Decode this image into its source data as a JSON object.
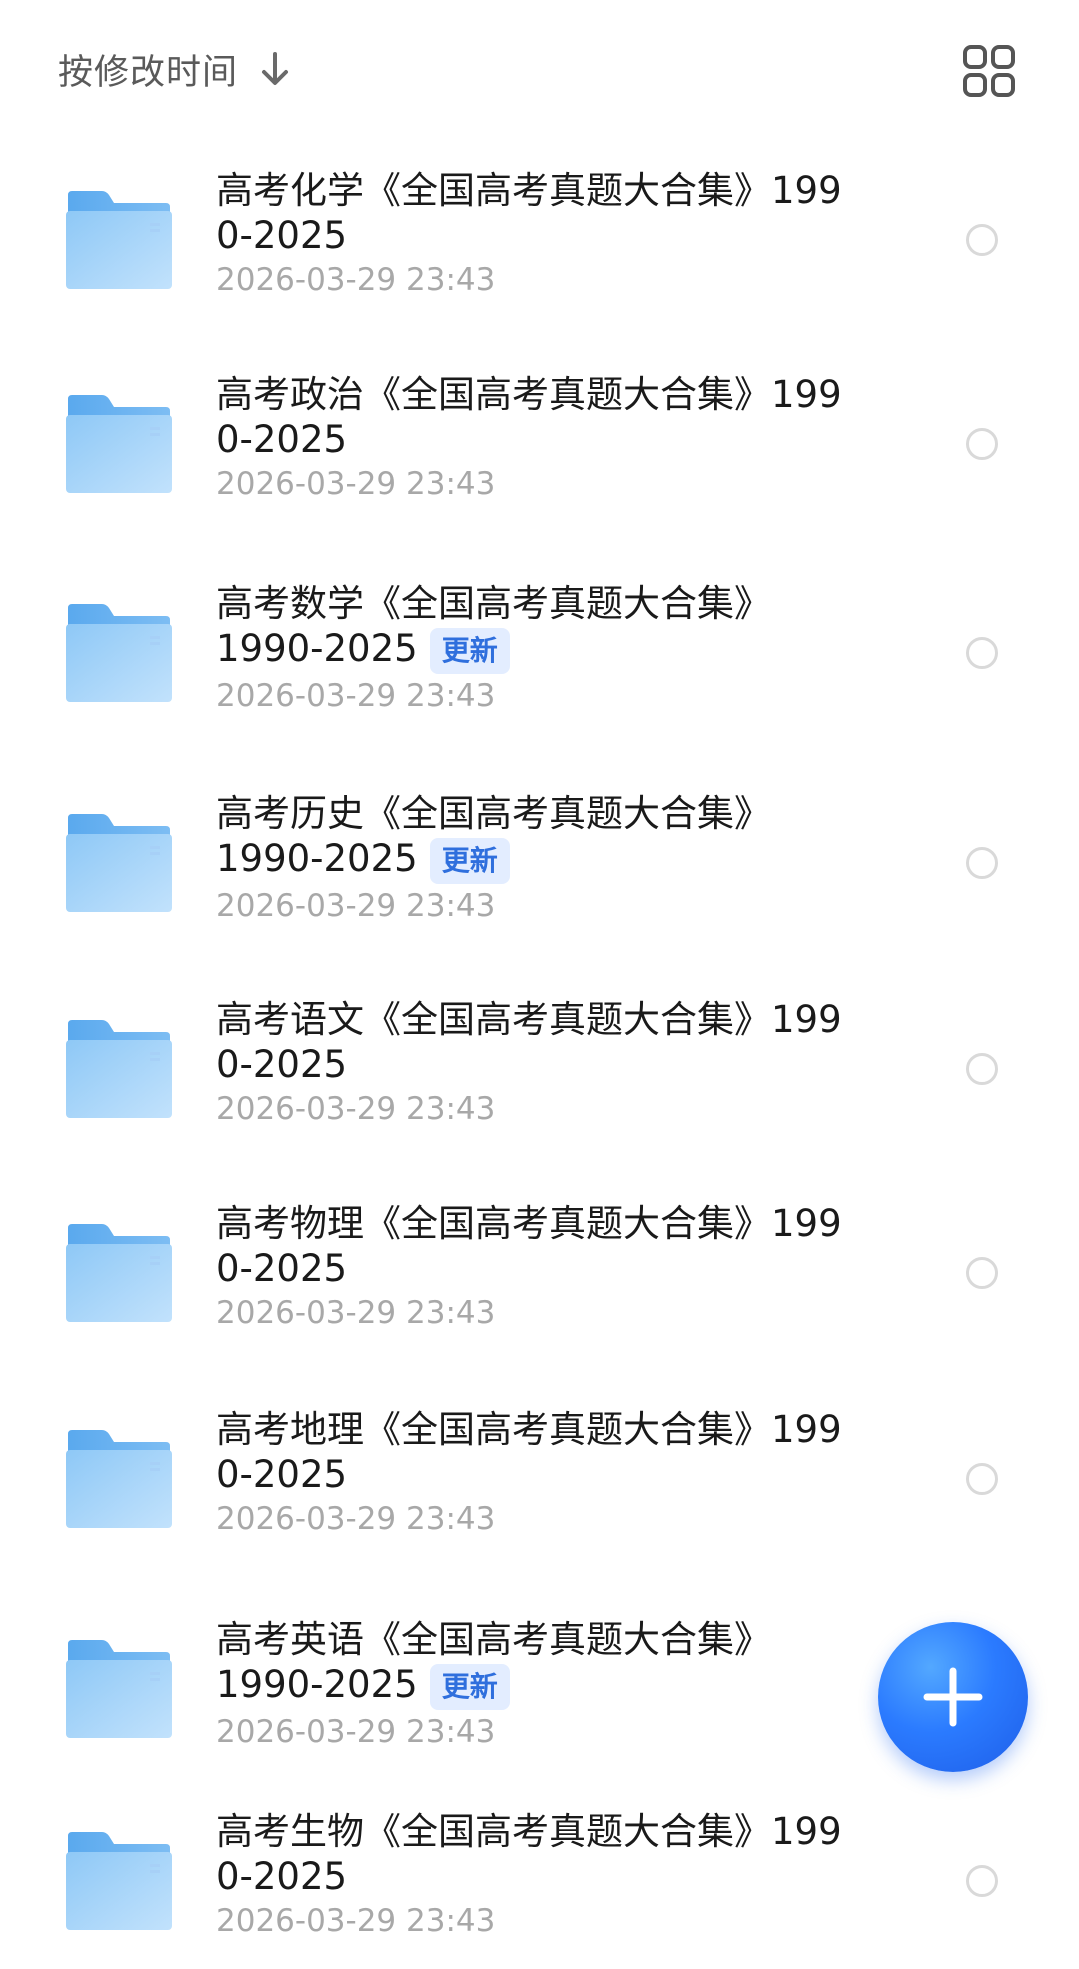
{
  "header": {
    "sort_label": "按修改时间",
    "sort_direction_icon": "arrow-down-icon",
    "view_toggle_icon": "grid-view-icon"
  },
  "files": [
    {
      "name": "高考化学《全国高考真题大合集》1990-2025",
      "date": "2026-03-29 23:43",
      "badge": "",
      "selected": false
    },
    {
      "name": "高考政治《全国高考真题大合集》1990-2025",
      "date": "2026-03-29 23:43",
      "badge": "",
      "selected": false
    },
    {
      "name": "高考数学《全国高考真题大合集》1990-2025",
      "date": "2026-03-29 23:43",
      "badge": "更新",
      "selected": false
    },
    {
      "name": "高考历史《全国高考真题大合集》1990-2025",
      "date": "2026-03-29 23:43",
      "badge": "更新",
      "selected": false
    },
    {
      "name": "高考语文《全国高考真题大合集》1990-2025",
      "date": "2026-03-29 23:43",
      "badge": "",
      "selected": false
    },
    {
      "name": "高考物理《全国高考真题大合集》1990-2025",
      "date": "2026-03-29 23:43",
      "badge": "",
      "selected": false
    },
    {
      "name": "高考地理《全国高考真题大合集》1990-2025",
      "date": "2026-03-29 23:43",
      "badge": "",
      "selected": false
    },
    {
      "name": "高考英语《全国高考真题大合集》1990-2025",
      "date": "2026-03-29 23:43",
      "badge": "更新",
      "selected": false
    },
    {
      "name": "高考生物《全国高考真题大合集》1990-2025",
      "date": "2026-03-29 23:43",
      "badge": "",
      "selected": false
    }
  ],
  "fab": {
    "icon": "plus-icon"
  },
  "colors": {
    "folder_light": "#b5dcfb",
    "folder_dark": "#7fbef4",
    "badge_text": "#2f6fdd",
    "badge_bg": "#e3edff",
    "fab": "#2b7bff",
    "date_text": "#a8a8a8"
  }
}
